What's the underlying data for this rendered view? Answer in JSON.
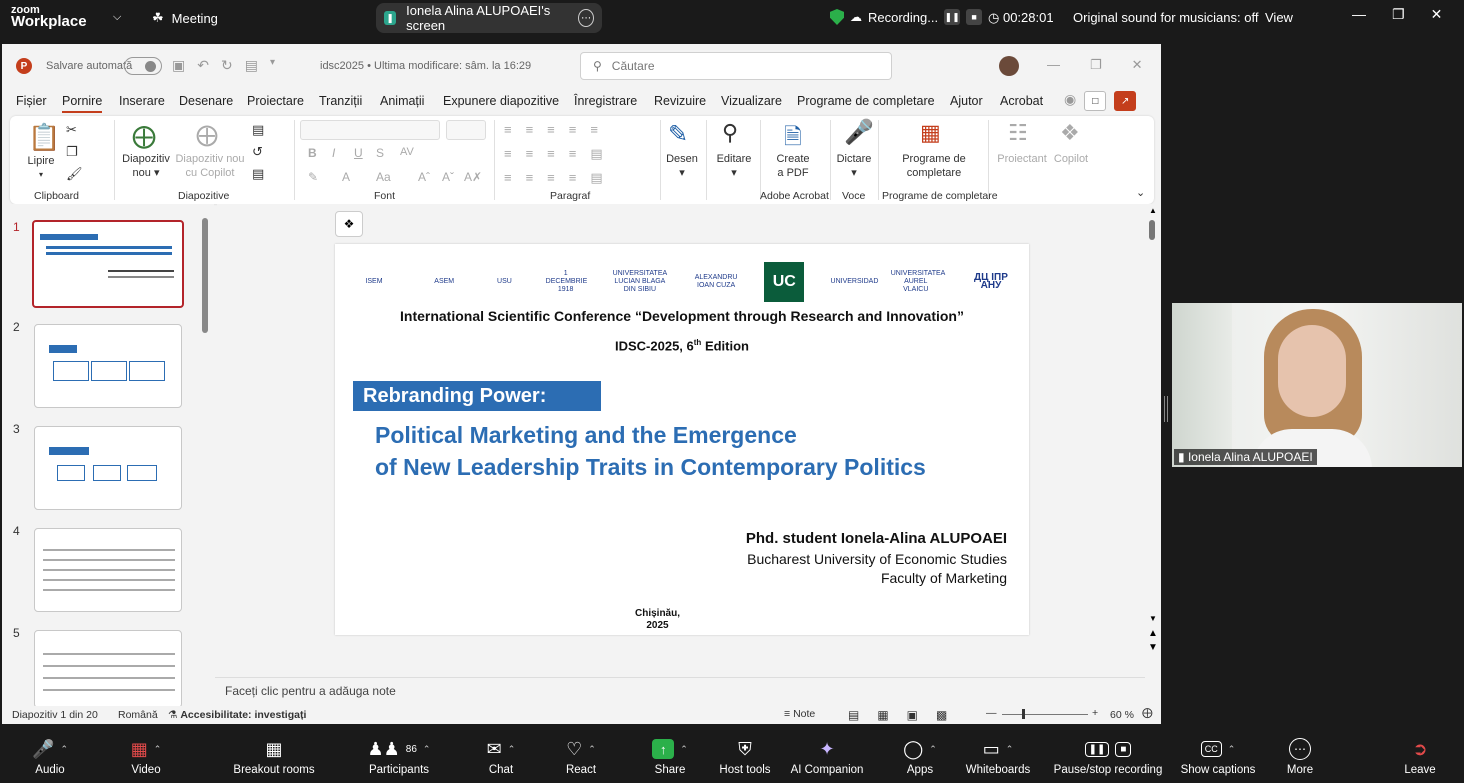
{
  "zoom_top": {
    "logo_line1": "zoom",
    "logo_line2": "Workplace",
    "meeting_label": "Meeting",
    "screen_share_label": "Ionela Alina ALUPOAEI's screen",
    "recording_label": "Recording...",
    "timer": "00:28:01",
    "original_sound": "Original sound for musicians: off",
    "view_label": "View"
  },
  "ppt": {
    "autosave_label": "Salvare automată",
    "doc_name": "idsc2025 • Ultima modificare: sâm. la 16:29",
    "search_placeholder": "Căutare",
    "menu": [
      "Fișier",
      "Pornire",
      "Inserare",
      "Desenare",
      "Proiectare",
      "Tranziții",
      "Animații",
      "Expunere diapozitive",
      "Înregistrare",
      "Revizuire",
      "Vizualizare",
      "Programe de completare",
      "Ajutor",
      "Acrobat"
    ],
    "ribbon": {
      "paste": "Lipire",
      "clipboard_group": "Clipboard",
      "new_slide_l1": "Diapozitiv",
      "new_slide_l2": "nou",
      "copilot_slide_l1": "Diapozitiv nou",
      "copilot_slide_l2": "cu Copilot",
      "slides_group": "Diapozitive",
      "font_group": "Font",
      "paragraph_group": "Paragraf",
      "designer": "Desen",
      "editing": "Editare",
      "create_pdf_l1": "Create",
      "create_pdf_l2": "a PDF",
      "acrobat_group": "Adobe Acrobat",
      "dictate": "Dictare",
      "voice_group": "Voce",
      "addins_l1": "Programe de",
      "addins_l2": "completare",
      "addins_group": "Programe de completare",
      "designer2": "Proiectant",
      "copilot": "Copilot"
    },
    "thumb_numbers": [
      "1",
      "2",
      "3",
      "4",
      "5"
    ],
    "slide": {
      "logos": [
        "ISEM",
        "ASEM",
        "USU",
        "1 DECEMBRIE 1918",
        "UNIVERSITATEA LUCIAN BLAGA DIN SIBIU",
        "ALEXANDRU IOAN CUZA",
        "UC",
        "UNIVERSIDAD",
        "UNIVERSITATEA AUREL VLAICU",
        "ДЦ ІПР АНУ"
      ],
      "conference_title": "International Scientific Conference “Development through Research and Innovation”",
      "edition_prefix": "IDSC-2025, 6",
      "edition_sup": "th",
      "edition_suffix": " Edition",
      "rebranding": "Rebranding Power:",
      "title_line1": "Political Marketing and the Emergence",
      "title_line2": "of New Leadership Traits in Contemporary Politics",
      "author": "Phd. student Ionela-Alina ALUPOAEI",
      "university": "Bucharest University of Economic Studies",
      "faculty": "Faculty of Marketing",
      "place": "Chișinău,",
      "year": "2025"
    },
    "notes_placeholder": "Faceți clic pentru a adăuga note",
    "status": {
      "slide_count": "Diapozitiv 1 din 20",
      "language": "Română",
      "accessibility": "Accesibilitate: investigați",
      "notes": "Note",
      "zoom": "60 %"
    }
  },
  "camera": {
    "name": "Ionela Alina ALUPOAEI"
  },
  "zoom_bottom": {
    "audio": "Audio",
    "video": "Video",
    "breakout": "Breakout rooms",
    "participants": "Participants",
    "participants_count": "86",
    "chat": "Chat",
    "react": "React",
    "share": "Share",
    "host_tools": "Host tools",
    "ai_companion": "AI Companion",
    "apps": "Apps",
    "whiteboards": "Whiteboards",
    "pause_recording": "Pause/stop recording",
    "captions": "Show captions",
    "more": "More",
    "leave": "Leave"
  },
  "colors": {
    "accent_red": "#c43e1c",
    "slide_blue": "#2c6db3",
    "share_green": "#2ca58d"
  }
}
